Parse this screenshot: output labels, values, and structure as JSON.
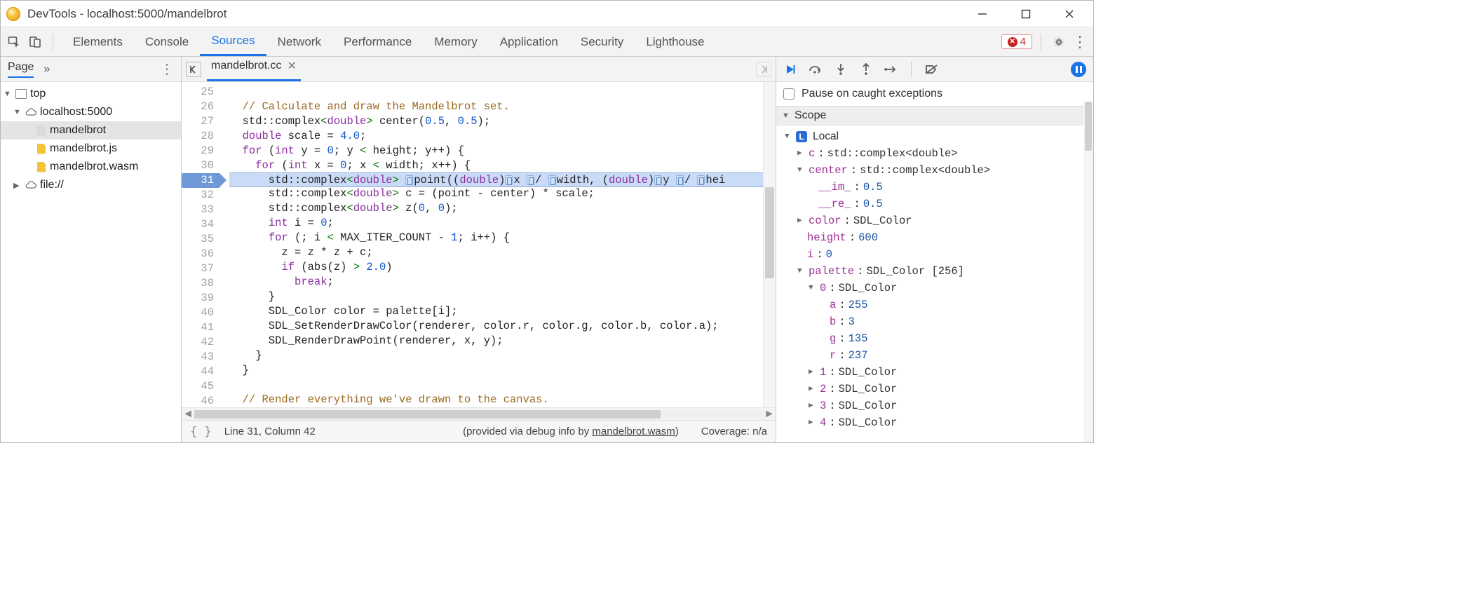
{
  "window": {
    "title": "DevTools - localhost:5000/mandelbrot"
  },
  "tabs": {
    "items": [
      "Elements",
      "Console",
      "Sources",
      "Network",
      "Performance",
      "Memory",
      "Application",
      "Security",
      "Lighthouse"
    ],
    "active": "Sources",
    "errorCount": "4"
  },
  "leftNav": {
    "tab": "Page",
    "more": "»",
    "root": "top",
    "domain": "localhost:5000",
    "files": [
      "mandelbrot",
      "mandelbrot.js",
      "mandelbrot.wasm"
    ],
    "file2": "file://"
  },
  "editor": {
    "tab": "mandelbrot.cc",
    "startLine": 25,
    "currentLine": 31,
    "lines": [
      "",
      "  // Calculate and draw the Mandelbrot set.",
      "  std::complex<double> center(0.5, 0.5);",
      "  double scale = 4.0;",
      "  for (int y = 0; y < height; y++) {",
      "    for (int x = 0; x < width; x++) {",
      "      std::complex<double> point((double)x / width, (double)y / hei",
      "      std::complex<double> c = (point - center) * scale;",
      "      std::complex<double> z(0, 0);",
      "      int i = 0;",
      "      for (; i < MAX_ITER_COUNT - 1; i++) {",
      "        z = z * z + c;",
      "        if (abs(z) > 2.0)",
      "          break;",
      "      }",
      "      SDL_Color color = palette[i];",
      "      SDL_SetRenderDrawColor(renderer, color.r, color.g, color.b, color.a);",
      "      SDL_RenderDrawPoint(renderer, x, y);",
      "    }",
      "  }",
      "",
      "  // Render everything we've drawn to the canvas.",
      ""
    ]
  },
  "status": {
    "pos": "Line 31, Column 42",
    "debugPrefix": "(provided via debug info by ",
    "debugFile": "mandelbrot.wasm",
    "debugSuffix": ")",
    "coverage": "Coverage: n/a"
  },
  "rightPanel": {
    "pauseOnCaught": "Pause on caught exceptions",
    "scopeTitle": "Scope",
    "localTitle": "Local",
    "vars": {
      "c": {
        "name": "c",
        "type": "std::complex<double>"
      },
      "center": {
        "name": "center",
        "type": "std::complex<double>",
        "im": {
          "k": "__im_",
          "v": "0.5"
        },
        "re": {
          "k": "__re_",
          "v": "0.5"
        }
      },
      "color": {
        "name": "color",
        "type": "SDL_Color"
      },
      "height": {
        "name": "height",
        "v": "600"
      },
      "i": {
        "name": "i",
        "v": "0"
      },
      "palette": {
        "name": "palette",
        "type": "SDL_Color [256]",
        "idx0": {
          "k": "0",
          "type": "SDL_Color",
          "a": {
            "k": "a",
            "v": "255"
          },
          "b": {
            "k": "b",
            "v": "3"
          },
          "g": {
            "k": "g",
            "v": "135"
          },
          "r": {
            "k": "r",
            "v": "237"
          }
        },
        "idx1": {
          "k": "1",
          "type": "SDL_Color"
        },
        "idx2": {
          "k": "2",
          "type": "SDL_Color"
        },
        "idx3": {
          "k": "3",
          "type": "SDL_Color"
        },
        "idx4": {
          "k": "4",
          "type": "SDL_Color"
        }
      }
    }
  }
}
